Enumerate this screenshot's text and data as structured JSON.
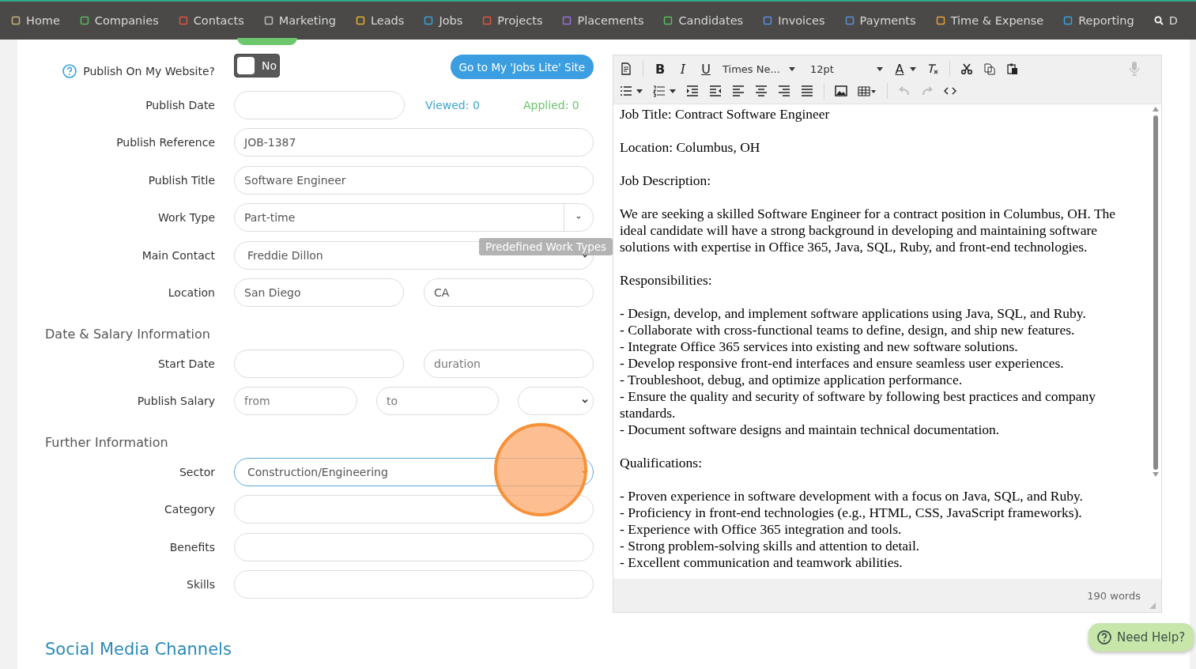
{
  "nav": [
    {
      "kind": "link",
      "label": "Home",
      "color": "#c8b27a"
    },
    {
      "kind": "link",
      "label": "Companies",
      "color": "#5cb85c"
    },
    {
      "kind": "link",
      "label": "Contacts",
      "color": "#e0533e"
    },
    {
      "kind": "link",
      "label": "Marketing",
      "color": "#bbbbbb"
    },
    {
      "kind": "link",
      "label": "Leads",
      "color": "#e8b030"
    },
    {
      "kind": "link",
      "label": "Jobs",
      "color": "#3aa0d8"
    },
    {
      "kind": "link",
      "label": "Projects",
      "color": "#e0533e"
    },
    {
      "kind": "link",
      "label": "Placements",
      "color": "#9b6ee0"
    },
    {
      "kind": "link",
      "label": "Candidates",
      "color": "#5cb85c"
    },
    {
      "kind": "link",
      "label": "Invoices",
      "color": "#5a8ee0"
    },
    {
      "kind": "link",
      "label": "Payments",
      "color": "#5a8ee0"
    },
    {
      "kind": "link",
      "label": "Time & Expense",
      "color": "#e8a040"
    },
    {
      "kind": "link",
      "label": "Reporting",
      "color": "#3aa0d8"
    },
    {
      "kind": "search",
      "label": "D"
    }
  ],
  "publish": {
    "label": "Publish On My Website?",
    "toggle": {
      "label": "No",
      "on": false
    },
    "site_button": "Go to My 'Jobs Lite' Site"
  },
  "sections": [
    {
      "rows": [
        {
          "kind": "date-stats",
          "label": "Publish Date",
          "viewed": "Viewed: 0",
          "applied": "Applied: 0"
        },
        {
          "kind": "text",
          "label": "Publish Reference",
          "value": "JOB-1387"
        },
        {
          "kind": "text",
          "label": "Publish Title",
          "value": "Software Engineer"
        },
        {
          "kind": "addon-select",
          "label": "Work Type",
          "value": "Part-time",
          "tooltip": "Predefined Work Types"
        },
        {
          "kind": "select",
          "label": "Main Contact",
          "value": "Freddie Dillon",
          "focused": false
        },
        {
          "kind": "pair",
          "label": "Location",
          "fields": [
            {
              "value": "San Diego"
            },
            {
              "value": "CA"
            }
          ]
        }
      ]
    },
    {
      "title": "Date & Salary Information",
      "rows": [
        {
          "kind": "date-duration",
          "label": "Start Date",
          "duration_placeholder": "duration"
        },
        {
          "kind": "salary",
          "label": "Publish Salary",
          "fields": [
            {
              "placeholder": "from"
            },
            {
              "placeholder": "to"
            }
          ]
        }
      ]
    },
    {
      "title": "Further Information",
      "rows": [
        {
          "kind": "select",
          "label": "Sector",
          "value": "Construction/Engineering",
          "focused": true
        },
        {
          "kind": "text",
          "label": "Category"
        },
        {
          "kind": "text",
          "label": "Benefits"
        },
        {
          "kind": "text",
          "label": "Skills"
        }
      ]
    }
  ],
  "social_heading": "Social Media Channels",
  "editor": {
    "toolbar": {
      "bold": "B",
      "italic": "I",
      "underline": "U",
      "font": "Times Ne...",
      "size": "12pt",
      "color_letter": "A",
      "undo_disabled": true,
      "redo_disabled": true,
      "mic_disabled": true
    },
    "paragraphs": [
      [
        "Job Title: Contract Software Engineer"
      ],
      [
        "Location: Columbus, OH"
      ],
      [
        "Job Description:"
      ],
      [
        "We are seeking a skilled Software Engineer for a contract position in Columbus, OH. The ideal candidate will have a strong background in developing and maintaining software solutions with expertise in Office 365, Java, SQL, Ruby, and front-end technologies."
      ],
      [
        "Responsibilities:"
      ],
      [
        "- Design, develop, and implement software applications using Java, SQL, and Ruby.",
        "- Collaborate with cross-functional teams to define, design, and ship new features.",
        "- Integrate Office 365 services into existing and new software solutions.",
        "- Develop responsive front-end interfaces and ensure seamless user experiences.",
        "- Troubleshoot, debug, and optimize application performance.",
        "- Ensure the quality and security of software by following best practices and company standards.",
        "- Document software designs and maintain technical documentation."
      ],
      [
        "Qualifications:"
      ],
      [
        "- Proven experience in software development with a focus on Java, SQL, and Ruby.",
        "- Proficiency in front-end technologies (e.g., HTML, CSS, JavaScript frameworks).",
        "- Experience with Office 365 integration and tools.",
        "- Strong problem-solving skills and attention to detail.",
        "- Excellent communication and teamwork abilities."
      ]
    ],
    "word_count": "190 words"
  },
  "help_button": "Need Help?"
}
